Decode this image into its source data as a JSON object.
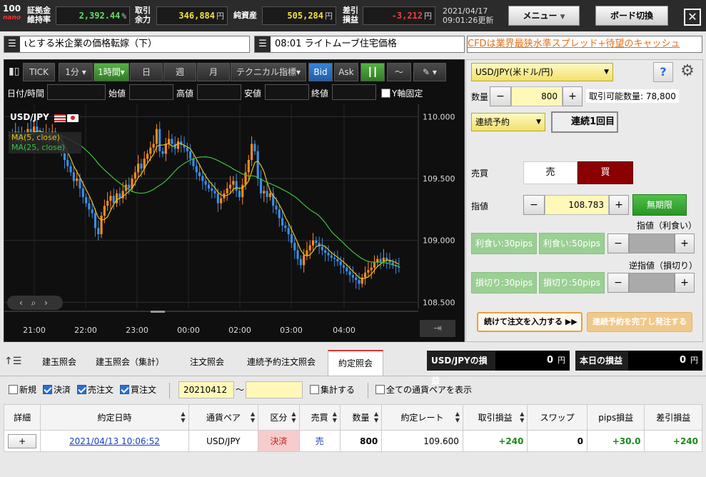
{
  "topbar": {
    "logo_top": "100",
    "logo_bottom": "nano",
    "margin_label1": "証拠金",
    "margin_label2": "維持率",
    "margin_value": "2,392.44",
    "margin_unit": "%",
    "funds_label1": "取引",
    "funds_label2": "余力",
    "funds_value": "346,884",
    "funds_unit": "円",
    "assets_label": "純資産",
    "assets_value": "505,284",
    "assets_unit": "円",
    "pl_label1": "差引",
    "pl_label2": "損益",
    "pl_value": "-3,212",
    "pl_unit": "円",
    "date": "2021/04/17",
    "time_updated": "09:01:26更新",
    "menu_label": "メニュー",
    "board_label": "ボード切換",
    "close_label": "✕"
  },
  "ticker": {
    "item1": "とする米企業の価格転嫁（下）",
    "item1_lead": "ɩ",
    "item2": "08:01 ライトムーブ住宅価格",
    "cfd_link": "CFDは業界最狭水準スプレッド+待望のキャッシュ"
  },
  "chart_toolbar": {
    "tick": "TICK",
    "min1": "1分",
    "hour1": "1時間",
    "day": "日",
    "week": "週",
    "month": "月",
    "technical": "テクニカル指標",
    "bid": "Bid",
    "ask": "Ask"
  },
  "ohlc": {
    "datetime": "日付/時間",
    "open": "始値",
    "high": "高値",
    "low": "安値",
    "close": "終値",
    "yfix": "Y軸固定"
  },
  "chart_data": {
    "type": "candlestick",
    "symbol": "USD/JPY",
    "legend": [
      "MA(5, close)",
      "MA(25, close)"
    ],
    "ylim": [
      108.45,
      110.1
    ],
    "yticks": [
      "110.000",
      "109.500",
      "109.000",
      "108.500"
    ],
    "xticks": [
      "21:00",
      "22:00",
      "23:00",
      "00:00",
      "02:00",
      "03:00",
      "04:00"
    ],
    "close_series": [
      109.85,
      109.82,
      109.88,
      109.8,
      109.86,
      109.83,
      109.9,
      109.87,
      109.92,
      109.88,
      109.86,
      109.83,
      109.87,
      109.85,
      109.88,
      109.82,
      109.78,
      109.72,
      109.65,
      109.6,
      109.55,
      109.48,
      109.5,
      109.42,
      109.35,
      109.3,
      109.25,
      109.22,
      109.1,
      109.05,
      109.2,
      109.28,
      109.32,
      109.36,
      109.3,
      109.38,
      109.34,
      109.4,
      109.45,
      109.42,
      109.5,
      109.55,
      109.62,
      109.58,
      109.66,
      109.7,
      109.75,
      109.78,
      109.9,
      109.72,
      109.7,
      109.78,
      109.82,
      109.78,
      109.74,
      109.8,
      109.77,
      109.75,
      109.72,
      109.66,
      109.6,
      109.55,
      109.52,
      109.48,
      109.45,
      109.42,
      109.4,
      109.38,
      109.3,
      109.34,
      109.38,
      109.42,
      109.45,
      109.48,
      109.4,
      109.35,
      109.45,
      109.55,
      109.65,
      109.78,
      109.72,
      109.5,
      109.38,
      109.4,
      109.35,
      109.38,
      109.28,
      109.25,
      109.18,
      109.12,
      109.1,
      109.05,
      108.98,
      108.92,
      108.85,
      108.8,
      108.88,
      108.92,
      108.96,
      109.0,
      108.98,
      108.95,
      108.92,
      108.9,
      108.88,
      108.86,
      108.85,
      108.83,
      108.8,
      108.78,
      108.75,
      108.72,
      108.7,
      108.68,
      108.65,
      108.7,
      108.74,
      108.76,
      108.78,
      108.82,
      108.85,
      108.83,
      108.86,
      108.84,
      108.82,
      108.8,
      108.79,
      108.78
    ]
  },
  "order": {
    "pair": "USD/JPY(米ドル/円)",
    "qty_label": "数量",
    "qty": "800",
    "available": "取引可能数量: 78,800",
    "order_type": "連続予約",
    "sequence": "連続1回目",
    "side_label": "売買",
    "sell": "売",
    "buy": "買",
    "limit_label": "指値",
    "price": "108.783",
    "expiry": "無期限",
    "tp_label": "指値（利食い）",
    "tp30": "利食い:30pips",
    "tp50": "利食い:50pips",
    "sl_label": "逆指値（損切り）",
    "sl30": "損切り:30pips",
    "sl50": "損切り:50pips",
    "continue_btn": "続けて注文を入力する",
    "submit_btn": "連続予約を完了し発注する",
    "minus": "−",
    "plus": "+"
  },
  "bottom": {
    "tab1": "建玉照会",
    "tab2": "建玉照会（集計）",
    "tab3": "注文照会",
    "tab4": "連続予約注文照会",
    "tab5": "約定照会",
    "pair_pl_label": "USD/JPYの損益",
    "pair_pl_value": "0",
    "today_pl_label": "本日の損益",
    "today_pl_value": "0",
    "yen": "円",
    "f_new": "新規",
    "f_settle": "決済",
    "f_sell": "売注文",
    "f_buy": "買注文",
    "date_from": "20210412",
    "tilde": "〜",
    "aggregate": "集計する",
    "all_pairs": "全ての通貨ペアを表示",
    "headers": [
      "詳細",
      "約定日時",
      "通貨ペア",
      "区分",
      "売買",
      "数量",
      "約定レート",
      "取引損益",
      "スワップ",
      "pips損益",
      "差引損益"
    ],
    "row": {
      "detail": "+",
      "datetime": "2021/04/13 10:06:52",
      "pair": "USD/JPY",
      "type": "決済",
      "side": "売",
      "qty": "800",
      "rate": "109.600",
      "trade_pl": "+240",
      "swap": "0",
      "pips": "+30.0",
      "net_pl": "+240"
    }
  }
}
